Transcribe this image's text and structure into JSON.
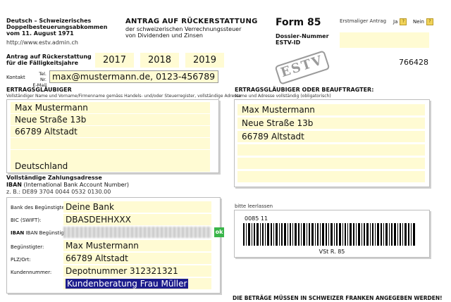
{
  "header": {
    "left_title_lines": [
      "Deutsch – Schweizerisches",
      "Doppelbesteuerungsabkommen",
      "vom 11. August 1971"
    ],
    "url": "http://www.estv.admin.ch",
    "center_title": "ANTRAG AUF RÜCKERSTATTUNG",
    "center_sub_lines": [
      "der schweizerischen Verrechnungssteuer",
      "von Dividenden und Zinsen"
    ],
    "form_label": "Form 85",
    "first_request_label": "Erstmaliger Antrag",
    "yes_label": "Ja",
    "no_label": "Nein",
    "dossier_label_lines": [
      "Dossier-Nummer",
      "ESTV-ID"
    ],
    "dossier_value": "",
    "stamp_text": "ESTV",
    "dossier_number": "766428"
  },
  "years": {
    "label_lines": [
      "Antrag auf Rückerstattung",
      "für die Fälligkeitsjahre"
    ],
    "values": [
      "2017",
      "2018",
      "2019"
    ]
  },
  "contact": {
    "label": "Kontakt",
    "sub_label_lines": [
      "Tel. Nr.",
      "E-Mail"
    ],
    "value": "max@mustermann.de, 0123-456789"
  },
  "creditor": {
    "title": "ERTRAGSGLÄUBIGER",
    "subtitle": "Vollständiger Name und Vorname/Firmenname gemäss Handels- und/oder Steuerregister, vollständige Adresse",
    "lines": [
      "Max Mustermann",
      "Neue Straße 13b",
      "66789 Altstadt",
      "",
      "",
      "Deutschland"
    ]
  },
  "agent": {
    "title": "ERTRAGSGLÄUBIGER ODER BEAUFTRAGTER:",
    "subtitle": "Name und Adresse vollständig (obligatorisch)",
    "lines": [
      "Max Mustermann",
      "Neue Straße 13b",
      "66789 Altstadt",
      "",
      "",
      ""
    ]
  },
  "payment": {
    "title": "Vollständige Zahlungsadresse",
    "iban_title": "IBAN",
    "iban_desc": "(International Bank Account Number)",
    "iban_example": "z. B.: DE89 3704 0044 0532 0130.00",
    "rows": [
      {
        "label": "Bank des Begünstigten:",
        "value": "Deine Bank"
      },
      {
        "label": "BIC (SWIFT):",
        "value": "DBASDEHHXXX"
      },
      {
        "label": "IBAN Begünstigter:",
        "value": ""
      },
      {
        "label": "Begünstigter:",
        "value": "Max Mustermann"
      },
      {
        "label": "PLZ/Ort:",
        "value": "66789 Altstadt"
      },
      {
        "label": "Kundennummer:",
        "value": "Depotnummer 312321321"
      },
      {
        "label": "",
        "value": "Kundenberatung Frau Müller"
      }
    ],
    "iban_ok": "ok"
  },
  "barcode": {
    "label": "bitte leerlassen",
    "number": "0085 11",
    "caption": "VSt R. 85"
  },
  "footer_note": "DIE BETRÄGE MÜSSEN IN SCHWEIZER FRANKEN ANGEGEBEN WERDEN!",
  "colors": {
    "field_bg": "#fffbd3",
    "ok_green": "#39b54a",
    "selection": "#1c1c8c"
  }
}
